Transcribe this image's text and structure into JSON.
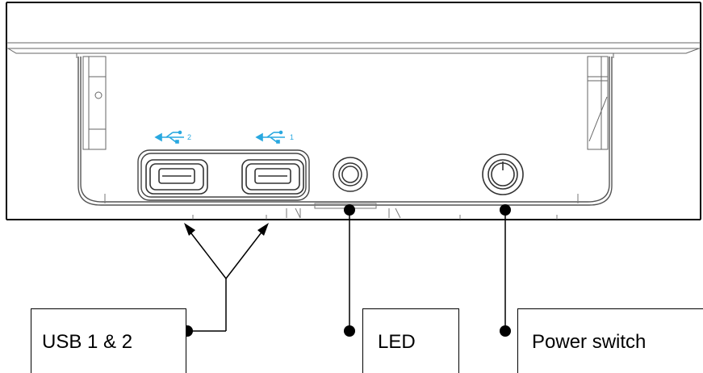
{
  "labels": {
    "usb": "USB 1 & 2",
    "led": "LED",
    "power": "Power switch"
  },
  "port_numbers": {
    "usb_left": "2",
    "usb_right": "1"
  },
  "colors": {
    "line": "#000000",
    "drawing": "#555555",
    "usb_icon": "#29a8e0",
    "background": "#ffffff"
  },
  "icons": [
    "usb-icon",
    "usb-port",
    "led-indicator",
    "power-button"
  ]
}
